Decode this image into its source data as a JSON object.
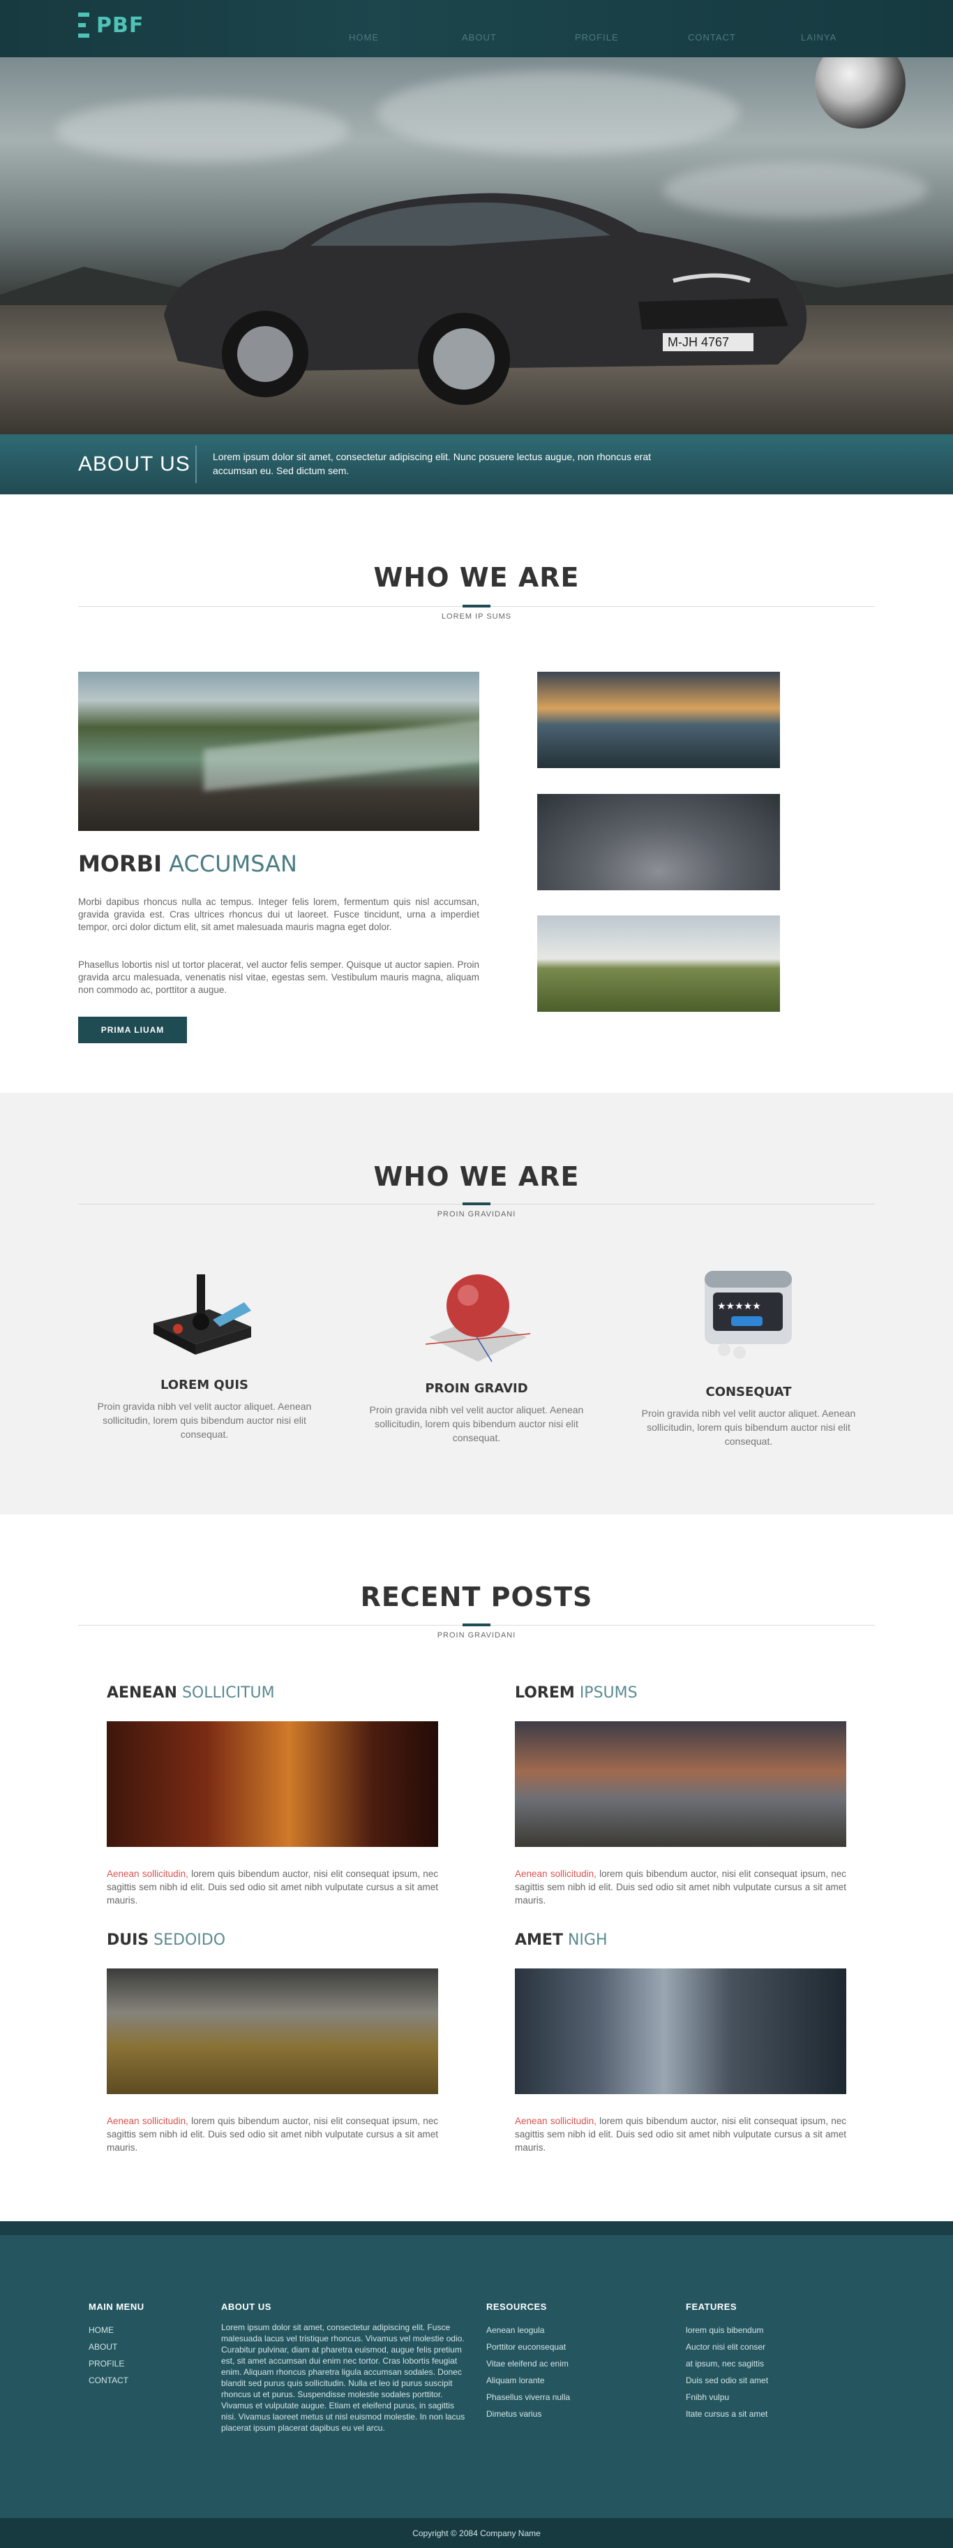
{
  "brand": {
    "logo_text": "PBF",
    "logo_icon": "stacked-bars-icon"
  },
  "nav": {
    "items": [
      "HOME",
      "ABOUT",
      "PROFILE",
      "CONTACT",
      "LAINYA"
    ]
  },
  "hero": {
    "image": "dark-bmw-coupe-on-gravel-road",
    "plate": "M-JH 4767"
  },
  "about": {
    "title": "ABOUT US",
    "text": "Lorem ipsum dolor sit amet, consectetur adipiscing elit. Nunc posuere lectus augue, non rhoncus erat accumsan eu. Sed dictum sem."
  },
  "who1": {
    "title": "WHO WE ARE",
    "subtitle": "LOREM IP SUMS",
    "heading_bold": "MORBI",
    "heading_light": "ACCUMSAN",
    "para1": "Morbi dapibus rhoncus nulla ac tempus. Integer felis lorem, fermentum quis nisl accumsan, gravida gravida est. Cras ultrices rhoncus dui ut laoreet. Fusce tincidunt, urna a imperdiet tempor, orci dolor dictum elit, sit amet malesuada mauris magna eget dolor.",
    "para2": "Phasellus lobortis nisl ut tortor placerat, vel auctor felis semper. Quisque ut auctor sapien. Proin gravida arcu malesuada, venenatis nisl vitae, egestas sem. Vestibulum mauris magna, aliquam non commodo ac, porttitor a augue.",
    "button": "PRIMA LIUAM"
  },
  "who2": {
    "title": "WHO WE ARE",
    "subtitle": "PROIN GRAVIDANI",
    "features": [
      {
        "title": "LOREM QUIS",
        "icon": "joystick-icon",
        "text": "Proin gravida nibh vel velit auctor aliquet. Aenean sollicitudin, lorem quis bibendum auctor nisi elit consequat."
      },
      {
        "title": "PROIN GRAVID",
        "icon": "red-ball-icon",
        "text": "Proin gravida nibh vel velit auctor aliquet. Aenean sollicitudin, lorem quis bibendum auctor nisi elit consequat."
      },
      {
        "title": "CONSEQUAT",
        "icon": "rating-window-icon",
        "text": "Proin gravida nibh vel velit auctor aliquet. Aenean sollicitudin, lorem quis bibendum auctor nisi elit consequat."
      }
    ]
  },
  "posts": {
    "title": "RECENT POSTS",
    "subtitle": "PROIN GRAVIDANI",
    "items": [
      {
        "bold": "AENEAN",
        "light": "SOLLICITUM",
        "link": "Aenean sollicitudin,",
        "text": " lorem quis bibendum auctor, nisi elit consequat ipsum, nec sagittis sem nibh id elit. Duis sed odio sit amet nibh vulputate cursus a sit amet mauris."
      },
      {
        "bold": "LOREM",
        "light": "IPSUMS",
        "link": "Aenean sollicitudin,",
        "text": " lorem quis bibendum auctor, nisi elit consequat ipsum, nec sagittis sem nibh id elit. Duis sed odio sit amet nibh vulputate cursus a sit amet mauris."
      },
      {
        "bold": "DUIS",
        "light": "SEDOIDO",
        "link": "Aenean sollicitudin,",
        "text": " lorem quis bibendum auctor, nisi elit consequat ipsum, nec sagittis sem nibh id elit. Duis sed odio sit amet nibh vulputate cursus a sit amet mauris."
      },
      {
        "bold": "AMET",
        "light": "NIGH",
        "link": "Aenean sollicitudin,",
        "text": " lorem quis bibendum auctor, nisi elit consequat ipsum, nec sagittis sem nibh id elit. Duis sed odio sit amet nibh vulputate cursus a sit amet mauris."
      }
    ]
  },
  "footer": {
    "main_menu": {
      "title": "MAIN MENU",
      "links": [
        "HOME",
        "ABOUT",
        "PROFILE",
        "CONTACT"
      ]
    },
    "about": {
      "title": "ABOUT US",
      "text": "Lorem ipsum dolor sit amet, consectetur adipiscing elit. Fusce malesuada lacus vel tristique rhoncus. Vivamus vel molestie odio. Curabitur pulvinar, diam at pharetra euismod, augue felis pretium est, sit amet accumsan dui enim nec tortor. Cras lobortis feugiat enim. Aliquam rhoncus pharetra ligula accumsan sodales. Donec blandit sed purus quis sollicitudin. Nulla et leo id purus suscipit rhoncus ut et purus. Suspendisse molestie sodales porttitor. Vivamus et vulputate augue. Etiam et eleifend purus, in sagittis nisi. Vivamus laoreet metus ut nisl euismod molestie. In non lacus placerat ipsum placerat dapibus eu vel arcu."
    },
    "resources": {
      "title": "RESOURCES",
      "links": [
        "Aenean leogula",
        "Porttitor euconsequat",
        "Vitae eleifend ac enim",
        "Aliquam lorante",
        "Phasellus viverra nulla",
        "Dimetus varius"
      ]
    },
    "features": {
      "title": "FEATURES",
      "links": [
        "lorem quis bibendum",
        "Auctor nisi elit conser",
        "at ipsum, nec sagittis",
        "Duis sed odio sit amet",
        "Fnibh vulpu",
        "Itate cursus a sit amet"
      ]
    },
    "copyright": "Copyright © 2084 Company Name"
  }
}
